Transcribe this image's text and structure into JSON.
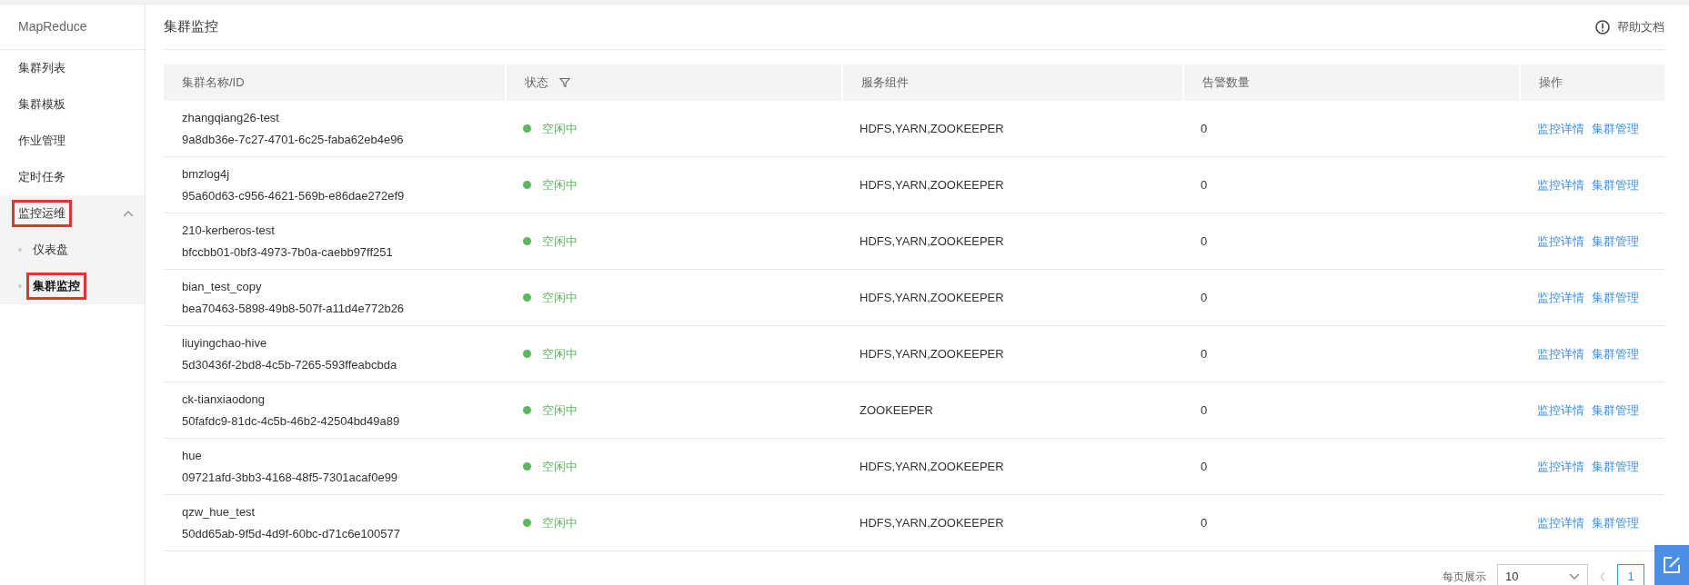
{
  "sidebar": {
    "title": "MapReduce",
    "items": [
      {
        "label": "集群列表",
        "selected": false,
        "marked": false
      },
      {
        "label": "集群模板",
        "selected": false,
        "marked": false
      },
      {
        "label": "作业管理",
        "selected": false,
        "marked": false
      },
      {
        "label": "定时任务",
        "selected": false,
        "marked": false
      },
      {
        "label": "监控运维",
        "selected": false,
        "marked": true,
        "expanded": true,
        "children": [
          {
            "label": "仪表盘",
            "selected": false,
            "marked": false
          },
          {
            "label": "集群监控",
            "selected": true,
            "marked": true
          }
        ]
      }
    ]
  },
  "header": {
    "title": "集群监控",
    "help": "帮助文档"
  },
  "table": {
    "columns": [
      "集群名称/ID",
      "状态",
      "服务组件",
      "告警数量",
      "操作"
    ],
    "rows": [
      {
        "name": "zhangqiang26-test",
        "id": "9a8db36e-7c27-4701-6c25-faba62eb4e96",
        "status": "空闲中",
        "color": "#5cb85c",
        "services": "HDFS,YARN,ZOOKEEPER",
        "alerts": "0",
        "actions": [
          "监控详情",
          "集群管理"
        ]
      },
      {
        "name": "bmzlog4j",
        "id": "95a60d63-c956-4621-569b-e86dae272ef9",
        "status": "空闲中",
        "color": "#5cb85c",
        "services": "HDFS,YARN,ZOOKEEPER",
        "alerts": "0",
        "actions": [
          "监控详情",
          "集群管理"
        ]
      },
      {
        "name": "210-kerberos-test",
        "id": "bfccbb01-0bf3-4973-7b0a-caebb97ff251",
        "status": "空闲中",
        "color": "#5cb85c",
        "services": "HDFS,YARN,ZOOKEEPER",
        "alerts": "0",
        "actions": [
          "监控详情",
          "集群管理"
        ]
      },
      {
        "name": "bian_test_copy",
        "id": "bea70463-5898-49b8-507f-a11d4e772b26",
        "status": "空闲中",
        "color": "#5cb85c",
        "services": "HDFS,YARN,ZOOKEEPER",
        "alerts": "0",
        "actions": [
          "监控详情",
          "集群管理"
        ]
      },
      {
        "name": "liuyingchao-hive",
        "id": "5d30436f-2bd8-4c5b-7265-593ffeabcbda",
        "status": "空闲中",
        "color": "#5cb85c",
        "services": "HDFS,YARN,ZOOKEEPER",
        "alerts": "0",
        "actions": [
          "监控详情",
          "集群管理"
        ]
      },
      {
        "name": "ck-tianxiaodong",
        "id": "50fafdc9-81dc-4c5b-46b2-42504bd49a89",
        "status": "空闲中",
        "color": "#5cb85c",
        "services": "ZOOKEEPER",
        "alerts": "0",
        "actions": [
          "监控详情",
          "集群管理"
        ]
      },
      {
        "name": "hue",
        "id": "09721afd-3bb3-4168-48f5-7301acaf0e99",
        "status": "空闲中",
        "color": "#5cb85c",
        "services": "HDFS,YARN,ZOOKEEPER",
        "alerts": "0",
        "actions": [
          "监控详情",
          "集群管理"
        ]
      },
      {
        "name": "qzw_hue_test",
        "id": "50dd65ab-9f5d-4d9f-60bc-d71c6e100577",
        "status": "空闲中",
        "color": "#5cb85c",
        "services": "HDFS,YARN,ZOOKEEPER",
        "alerts": "0",
        "actions": [
          "监控详情",
          "集群管理"
        ]
      }
    ]
  },
  "pagination": {
    "page_size_label": "每页展示",
    "page_size": "10",
    "pages": [
      {
        "label": "1",
        "selected": true
      }
    ]
  }
}
